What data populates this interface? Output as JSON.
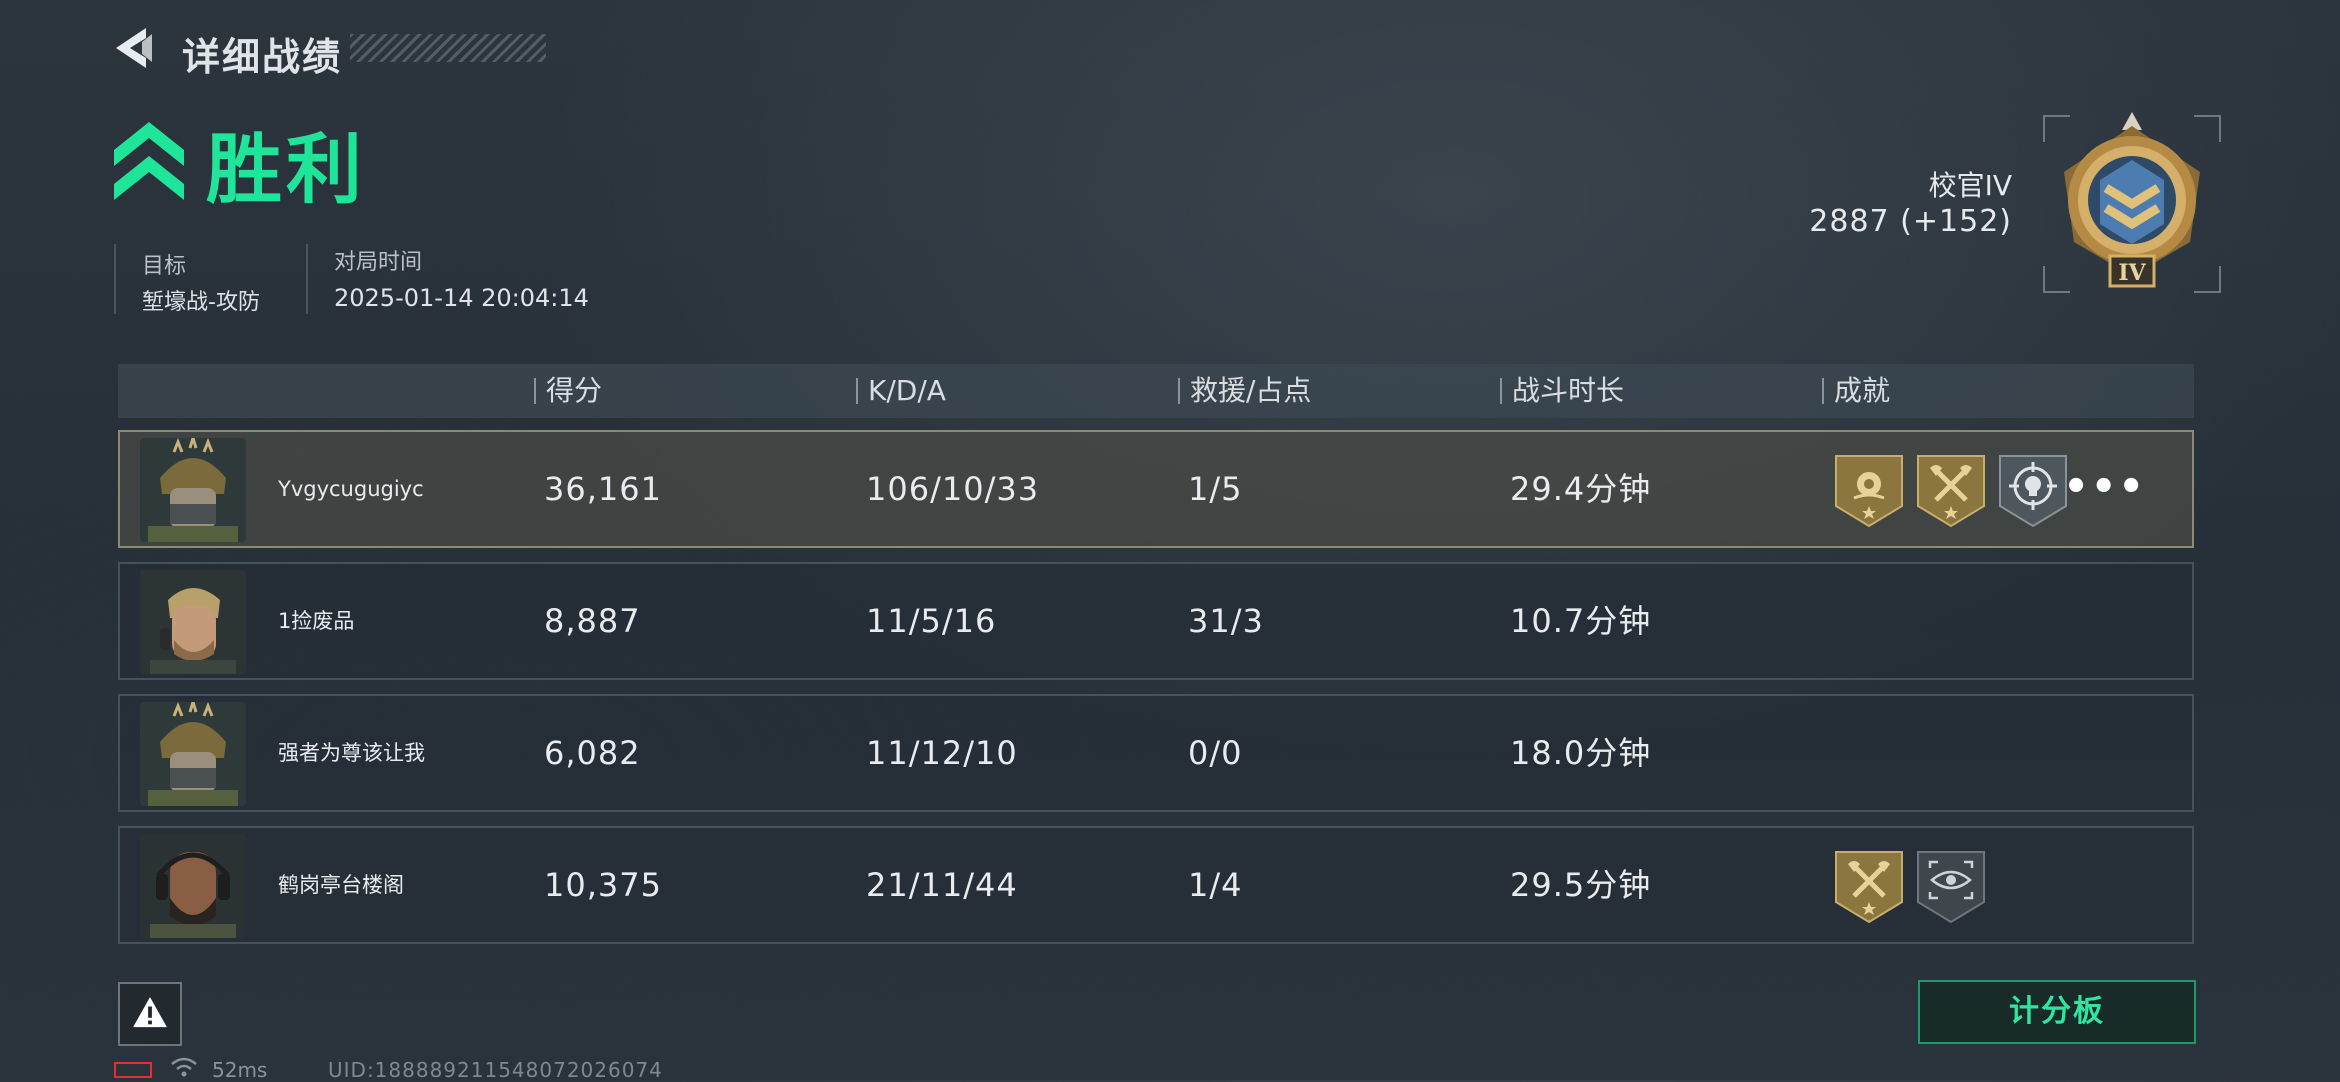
{
  "header": {
    "title": "详细战绩"
  },
  "result": {
    "text": "胜利",
    "color": "#1fe59a"
  },
  "info": {
    "mode_label": "目标",
    "mode_value": "堑壕战-攻防",
    "time_label": "对局时间",
    "time_value": "2025-01-14 20:04:14"
  },
  "rank": {
    "name": "校官IV",
    "score": "2887 (+152)",
    "emblem_numeral": "IV"
  },
  "table": {
    "headers": [
      "得分",
      "K/D/A",
      "救援/占点",
      "战斗时长",
      "成就"
    ],
    "rows": [
      {
        "name": "Yvgycugugiyc",
        "score": "36,161",
        "kda": "106/10/33",
        "rescue": "1/5",
        "duration": "29.4分钟",
        "highlighted": true,
        "achievements": [
          "rose-badge-icon",
          "axe-badge-icon",
          "skull-crosshair-badge-icon"
        ],
        "has_more": true
      },
      {
        "name": "1捡废品",
        "score": "8,887",
        "kda": "11/5/16",
        "rescue": "31/3",
        "duration": "10.7分钟",
        "achievements": []
      },
      {
        "name": "强者为尊该让我",
        "score": "6,082",
        "kda": "11/12/10",
        "rescue": "0/0",
        "duration": "18.0分钟",
        "achievements": []
      },
      {
        "name": "鹤岗亭台楼阁",
        "score": "10,375",
        "kda": "21/11/44",
        "rescue": "1/4",
        "duration": "29.5分钟",
        "achievements": [
          "axe-badge-icon",
          "eye-scope-badge-icon"
        ]
      }
    ],
    "more_label": "•••"
  },
  "footer": {
    "scoreboard_label": "计分板",
    "ping": "52ms",
    "uid": "UID:1888892115480720260​74"
  }
}
